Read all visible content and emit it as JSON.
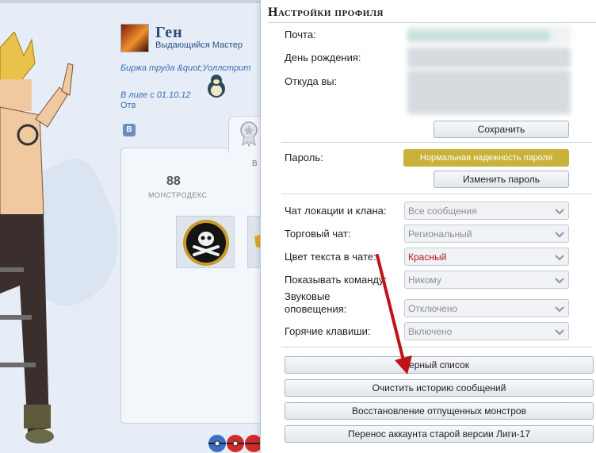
{
  "profile": {
    "name": "Ген",
    "status": "Выдающийся Мастер",
    "exchange_line": "Биржа труда &quot;Уоллстрит",
    "league_line": "В лиге с 01.10.12",
    "extra_line": "Отв",
    "vk_label": "В",
    "stat_value": "88",
    "stat_label": "МОНСТРОДЕКС",
    "card_letter": "В"
  },
  "settings": {
    "title": "Настройки профиля",
    "email_label": "Почта:",
    "birthday_label": "День рождения:",
    "location_label": "Откуда вы:",
    "save_button": "Сохранить",
    "password_label": "Пароль:",
    "password_strength": "Нормальная надежность пароля",
    "change_password_button": "Изменить пароль",
    "rows": [
      {
        "label": "Чат локации и клана:",
        "value": "Все сообщения"
      },
      {
        "label": "Торговый чат:",
        "value": "Региональный"
      },
      {
        "label": "Цвет текста в чате:",
        "value": "Красный"
      },
      {
        "label": "Показывать команду:",
        "value": "Никому"
      },
      {
        "label": "Звуковые\nоповещения:",
        "value": "Отключено"
      },
      {
        "label": "Горячие клавиши:",
        "value": "Включено"
      }
    ],
    "actions": {
      "blacklist": "ерный список",
      "clear_history": "Очистить историю сообщений",
      "restore_monsters": "Восстановление отпущенных монстров",
      "transfer_account": "Перенос аккаунта старой версии Лиги-17"
    }
  },
  "colors": {
    "chat_color_value": "#b2181b",
    "password_badge": "#c9b23a",
    "annotation_arrow": "#c0141a"
  }
}
